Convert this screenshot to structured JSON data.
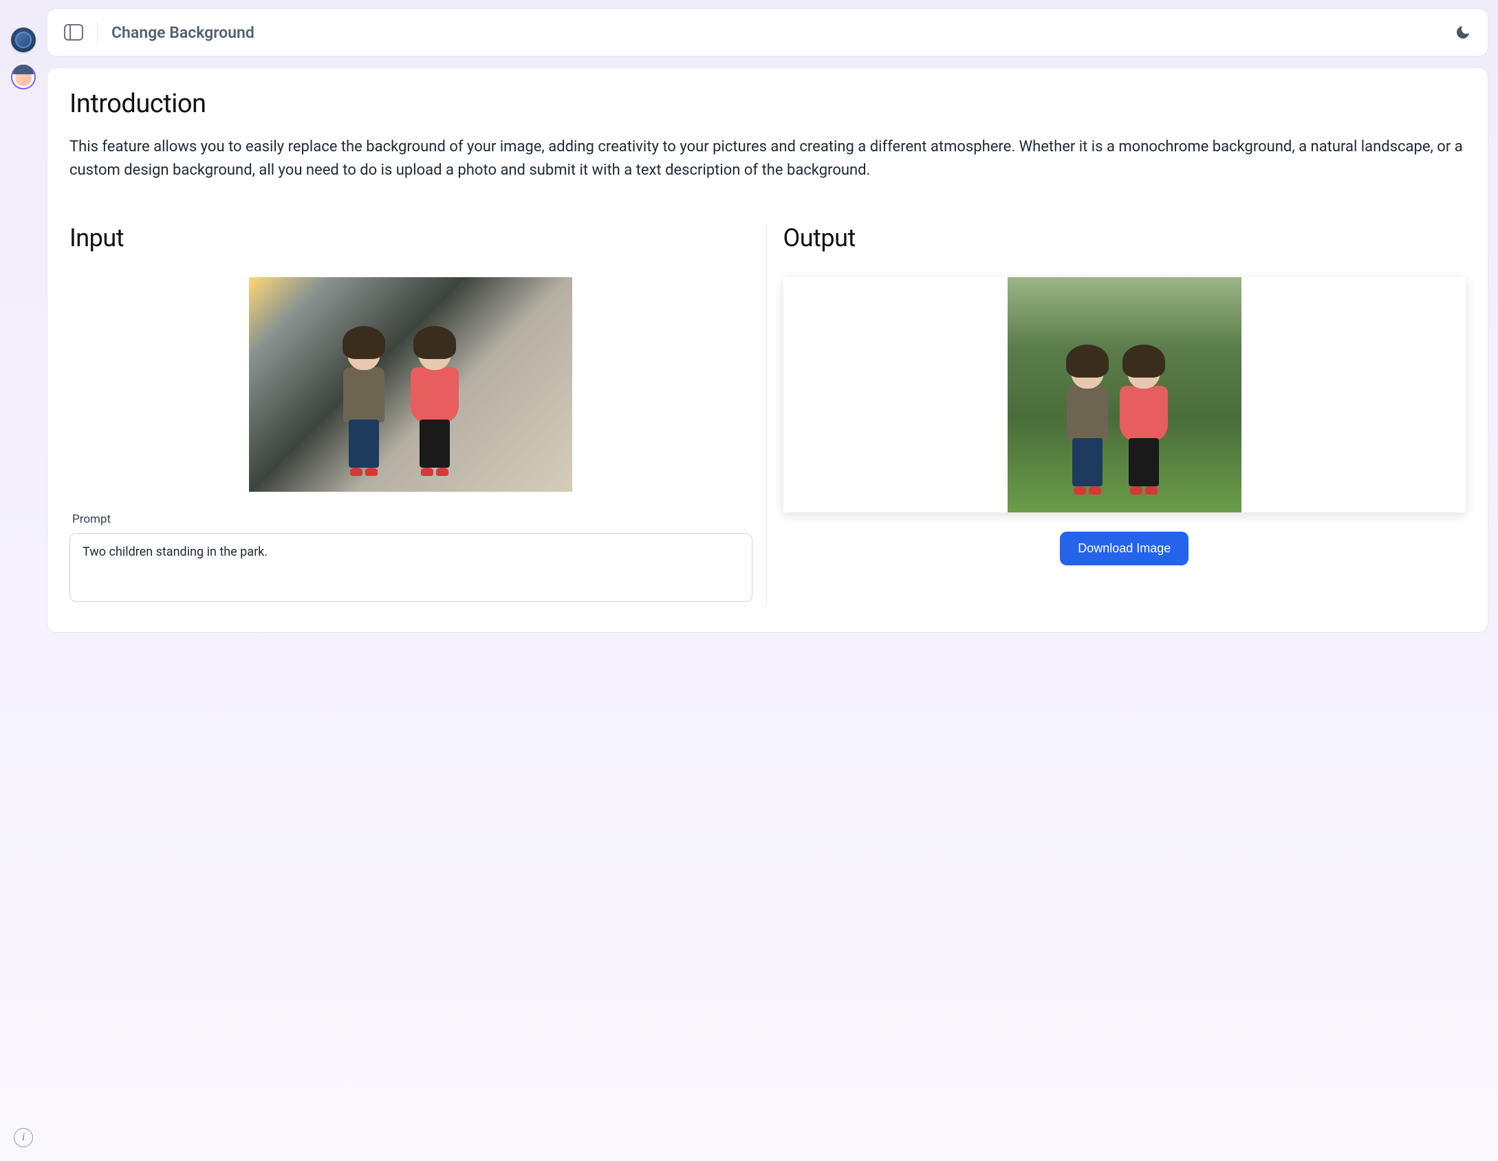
{
  "header": {
    "title": "Change Background"
  },
  "introduction": {
    "heading": "Introduction",
    "body": "This feature allows you to easily replace the background of your image, adding creativity to your pictures and creating a different atmosphere. Whether it is a monochrome background, a natural landscape, or a custom design background, all you need to do is upload a photo and submit it with a text description of the background."
  },
  "input": {
    "heading": "Input",
    "prompt_label": "Prompt",
    "prompt_value": "Two children standing in the park."
  },
  "output": {
    "heading": "Output",
    "download_label": "Download Image"
  },
  "rail": {
    "info_label": "i"
  }
}
